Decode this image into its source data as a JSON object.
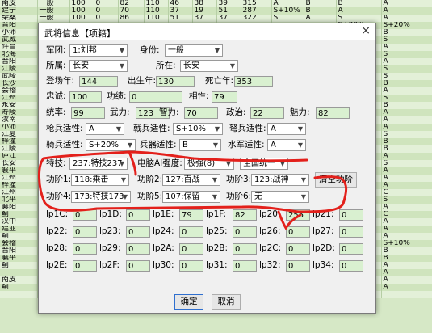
{
  "background_rows": [
    [
      "南皮",
      "一般",
      "100",
      "0",
      "82",
      "110",
      "46",
      "38",
      "39",
      "315",
      "A",
      "B",
      "B",
      "A"
    ],
    [
      "建宁",
      "一般",
      "100",
      "0",
      "70",
      "110",
      "37",
      "19",
      "51",
      "287",
      "S+10%",
      "B",
      "A",
      "A"
    ],
    [
      "柴桑",
      "一般",
      "100",
      "0",
      "86",
      "110",
      "51",
      "37",
      "37",
      "322",
      "S",
      "A",
      "S",
      "A"
    ],
    [
      "晋阳",
      "",
      "",
      "",
      "",
      "",
      "",
      "",
      "",
      "",
      "",
      "",
      "S+20%",
      "S+20%"
    ],
    [
      "小沛",
      "",
      "",
      "",
      "",
      "",
      "",
      "",
      "",
      "",
      "",
      "",
      "",
      "B"
    ],
    [
      "武威",
      "",
      "",
      "",
      "",
      "",
      "",
      "",
      "",
      "",
      "",
      "",
      "S+20%",
      "S"
    ],
    [
      "许昌",
      "",
      "",
      "",
      "",
      "",
      "",
      "",
      "",
      "",
      "",
      "",
      "B",
      "A"
    ],
    [
      "北海",
      "",
      "",
      "",
      "",
      "",
      "",
      "",
      "",
      "",
      "",
      "",
      "A",
      "S"
    ],
    [
      "晋阳",
      "",
      "",
      "",
      "",
      "",
      "",
      "",
      "",
      "",
      "",
      "",
      "S",
      "A"
    ],
    [
      "江陵",
      "",
      "",
      "",
      "",
      "",
      "",
      "",
      "",
      "",
      "",
      "",
      "S",
      "S"
    ],
    [
      "武陵",
      "",
      "",
      "",
      "",
      "",
      "",
      "",
      "",
      "",
      "",
      "",
      "S+10%",
      "S"
    ],
    [
      "长沙",
      "",
      "",
      "",
      "",
      "",
      "",
      "",
      "",
      "",
      "",
      "",
      "A",
      "B"
    ],
    [
      "会稽",
      "",
      "",
      "",
      "",
      "",
      "",
      "",
      "",
      "",
      "",
      "",
      "B",
      "A"
    ],
    [
      "江州",
      "",
      "",
      "",
      "",
      "",
      "",
      "",
      "",
      "",
      "",
      "",
      "S",
      "S"
    ],
    [
      "永安",
      "",
      "",
      "",
      "",
      "",
      "",
      "",
      "",
      "",
      "",
      "",
      "C",
      "B"
    ],
    [
      "寿陵",
      "",
      "",
      "",
      "",
      "",
      "",
      "",
      "",
      "",
      "",
      "",
      "B",
      "A"
    ],
    [
      "汝南",
      "",
      "",
      "",
      "",
      "",
      "",
      "",
      "",
      "",
      "",
      "",
      "B",
      "A"
    ],
    [
      "小沛",
      "",
      "",
      "",
      "",
      "",
      "",
      "",
      "",
      "",
      "",
      "",
      "A",
      "A"
    ],
    [
      "江夏",
      "",
      "",
      "",
      "",
      "",
      "",
      "",
      "",
      "",
      "",
      "",
      "A",
      "S"
    ],
    [
      "梓潼",
      "",
      "",
      "",
      "",
      "",
      "",
      "",
      "",
      "",
      "",
      "",
      "A",
      "B"
    ],
    [
      "江陵",
      "",
      "",
      "",
      "",
      "",
      "",
      "",
      "",
      "",
      "",
      "",
      "A",
      "B"
    ],
    [
      "庐江",
      "",
      "",
      "",
      "",
      "",
      "",
      "",
      "",
      "",
      "",
      "",
      "A",
      "A"
    ],
    [
      "长安",
      "",
      "",
      "",
      "",
      "",
      "",
      "",
      "",
      "",
      "",
      "",
      "S+10%",
      "S"
    ],
    [
      "襄平",
      "",
      "",
      "",
      "",
      "",
      "",
      "",
      "",
      "",
      "",
      "",
      "A",
      "A"
    ],
    [
      "江州",
      "",
      "",
      "",
      "",
      "",
      "",
      "",
      "",
      "",
      "",
      "",
      "A",
      "A"
    ],
    [
      "梓潼",
      "",
      "",
      "",
      "",
      "",
      "",
      "",
      "",
      "",
      "",
      "",
      "B",
      "A"
    ],
    [
      "江州",
      "",
      "",
      "",
      "",
      "",
      "",
      "",
      "",
      "",
      "",
      "",
      "A",
      "C"
    ],
    [
      "北平",
      "",
      "",
      "",
      "",
      "",
      "",
      "",
      "",
      "",
      "",
      "",
      "S",
      "S"
    ],
    [
      "襄阳",
      "",
      "",
      "",
      "",
      "",
      "",
      "",
      "",
      "",
      "",
      "",
      "A",
      "A"
    ],
    [
      "蓟",
      "",
      "",
      "",
      "",
      "",
      "",
      "",
      "",
      "",
      "",
      "",
      "C",
      "C"
    ],
    [
      "汉中",
      "",
      "",
      "",
      "",
      "",
      "",
      "",
      "",
      "",
      "",
      "",
      "S+20%",
      "A"
    ],
    [
      "建业",
      "",
      "",
      "",
      "",
      "",
      "",
      "",
      "",
      "",
      "",
      "",
      "A",
      "A"
    ],
    [
      "蓟",
      "",
      "",
      "",
      "",
      "",
      "",
      "",
      "",
      "",
      "",
      "",
      "A",
      "A"
    ],
    [
      "会稽",
      "",
      "",
      "",
      "",
      "",
      "",
      "",
      "",
      "",
      "",
      "",
      "C",
      "S+10%"
    ],
    [
      "晋阳",
      "",
      "",
      "",
      "",
      "",
      "",
      "",
      "",
      "",
      "",
      "",
      "C",
      "B"
    ],
    [
      "襄平",
      "",
      "",
      "",
      "",
      "",
      "",
      "",
      "",
      "",
      "",
      "",
      "B",
      "B"
    ],
    [
      "蓟",
      "",
      "",
      "",
      "",
      "",
      "",
      "",
      "",
      "",
      "",
      "",
      "A",
      "A"
    ],
    [
      "",
      "",
      "",
      "",
      "",
      "",
      "",
      "",
      "",
      "",
      "",
      "",
      "B",
      "A"
    ],
    [
      "南皮",
      "一般",
      "100",
      "0",
      "79",
      "95",
      "66",
      "20",
      "25",
      "285",
      "A",
      "A",
      "B",
      "A"
    ],
    [
      "蓟",
      "一般",
      "100",
      "0",
      "80",
      "95",
      "78",
      "32",
      "82",
      "375",
      "A",
      "A",
      "B",
      "A"
    ],
    [
      "",
      "一般",
      "100",
      "0",
      "",
      "",
      "",
      "",
      "",
      "",
      "",
      "",
      "",
      ""
    ]
  ],
  "dialog": {
    "title": "武将信息【项籍】",
    "close": "×",
    "army_label": "军团:",
    "army_value": "1:刘邦",
    "status_label": "身份:",
    "status_value": "一般",
    "belong_label": "所属:",
    "belong_value": "长安",
    "location_label": "所在:",
    "location_value": "长安",
    "debut_label": "登场年:",
    "debut_value": "144",
    "birth_label": "出生年:",
    "birth_value": "130",
    "death_label": "死亡年:",
    "death_value": "353",
    "loyalty_label": "忠诚:",
    "loyalty_value": "100",
    "merit_label": "功绩:",
    "merit_value": "0",
    "compat_label": "相性:",
    "compat_value": "79",
    "lead_label": "统率:",
    "lead_value": "99",
    "war_label": "武力:",
    "war_value": "123",
    "intel_label": "智力:",
    "intel_value": "70",
    "pol_label": "政治:",
    "pol_value": "22",
    "charm_label": "魅力:",
    "charm_value": "82",
    "spear_label": "枪兵适性:",
    "spear_value": "A",
    "pike_label": "戟兵适性:",
    "pike_value": "S+10%",
    "bow_label": "弩兵适性:",
    "bow_value": "A",
    "cav_label": "骑兵适性:",
    "cav_value": "S+20%",
    "siege_label": "兵器适性:",
    "siege_value": "B",
    "navy_label": "水军适性:",
    "navy_value": "A",
    "skill_label": "特技:",
    "skill_value": "237:特技237",
    "ai_label": "电脑AI强度:",
    "ai_value": "极强(8)",
    "unify_value": "全国统一",
    "rank1_label": "功阶1:",
    "rank1_value": "118:乘击",
    "rank2_label": "功阶2:",
    "rank2_value": "127:百战",
    "rank3_label": "功阶3:",
    "rank3_value": "123:战神",
    "rank4_label": "功阶4:",
    "rank4_value": "173:特技173",
    "rank5_label": "功阶5:",
    "rank5_value": "107:保留",
    "rank6_label": "功阶6:",
    "rank6_value": "无",
    "clear_button": "清空功阶",
    "ok_button": "确定",
    "cancel_button": "取消",
    "params": [
      {
        "label": "lp1C:",
        "value": "0"
      },
      {
        "label": "lp1D:",
        "value": "0"
      },
      {
        "label": "lp1E:",
        "value": "79"
      },
      {
        "label": "lp1F:",
        "value": "82"
      },
      {
        "label": "lp20:",
        "value": "255"
      },
      {
        "label": "lp21:",
        "value": "0"
      },
      {
        "label": "lp22:",
        "value": "0"
      },
      {
        "label": "lp23:",
        "value": "0"
      },
      {
        "label": "lp24:",
        "value": "0"
      },
      {
        "label": "lp25:",
        "value": "0"
      },
      {
        "label": "lp26:",
        "value": "0"
      },
      {
        "label": "lp27:",
        "value": "0"
      },
      {
        "label": "lp28:",
        "value": "0"
      },
      {
        "label": "lp29:",
        "value": "0"
      },
      {
        "label": "lp2A:",
        "value": "0"
      },
      {
        "label": "lp2B:",
        "value": "0"
      },
      {
        "label": "lp2C:",
        "value": "0"
      },
      {
        "label": "lp2D:",
        "value": "0"
      },
      {
        "label": "lp2E:",
        "value": "0"
      },
      {
        "label": "lp2F:",
        "value": "0"
      },
      {
        "label": "lp30:",
        "value": "0"
      },
      {
        "label": "lp31:",
        "value": "0"
      },
      {
        "label": "lp32:",
        "value": "0"
      },
      {
        "label": "lp34:",
        "value": "0"
      }
    ]
  },
  "colors": {
    "field_bg": "#d9f0d0",
    "annotation": "#e3201b",
    "row_light": "#e3f0d8",
    "row_dark": "#cfe4bd"
  }
}
